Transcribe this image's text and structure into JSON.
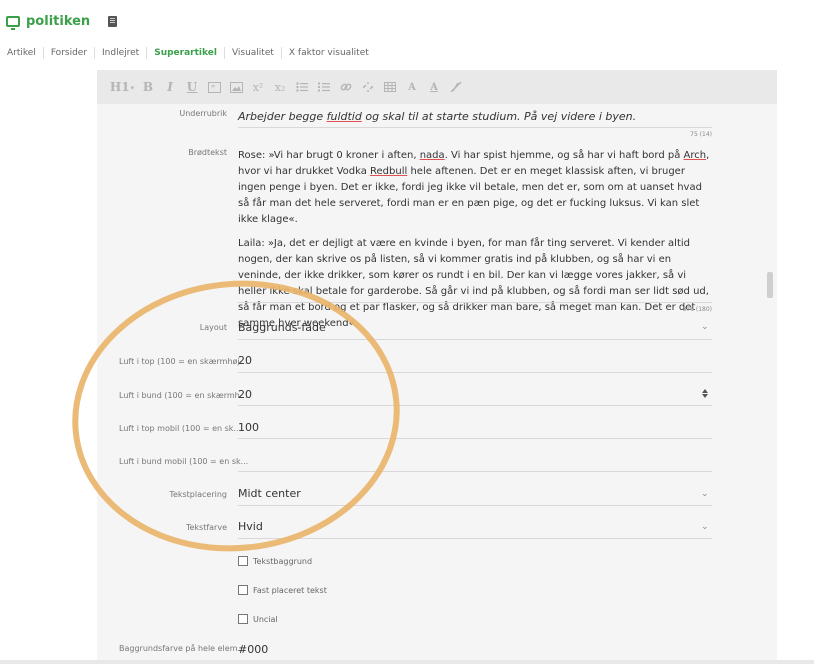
{
  "header": {
    "brand": "politiken"
  },
  "tabs": [
    {
      "label": "Artikel"
    },
    {
      "label": "Forsider"
    },
    {
      "label": "Indlejret"
    },
    {
      "label": "Superartikel",
      "active": true
    },
    {
      "label": "Visualitet"
    },
    {
      "label": "X faktor visualitet"
    }
  ],
  "toolbar": {
    "items": [
      "H1",
      "B",
      "I",
      "U",
      "quote",
      "image",
      "x²",
      "x₂",
      "list",
      "ordered-list",
      "link",
      "unlink",
      "table",
      "A",
      "A",
      "clear"
    ],
    "heading": "H1",
    "bold": "B",
    "italic": "I",
    "underline": "U",
    "superscript": "x²",
    "subscript": "x₂",
    "font_color": "A",
    "bg_color": "A"
  },
  "fields": {
    "underrubrik": {
      "label": "Underrubrik",
      "value_pre": "Arbejder begge ",
      "value_err": "fuldtid",
      "value_post": " og skal til at starte studium. På vej videre i byen.",
      "count": "75 (14)"
    },
    "brodtekst": {
      "label": "Brødtekst",
      "p1_a": "Rose: »Vi har brugt 0 kroner i aften, ",
      "p1_err1": "nada",
      "p1_b": ". Vi har spist hjemme, og så har vi haft bord på ",
      "p1_err2": "Arch",
      "p1_c": ", hvor vi har drukket Vodka ",
      "p1_err3": "Redbull",
      "p1_d": " hele aftenen. Det er en meget klassisk aften, vi bruger ingen penge i byen. Det er ikke, fordi jeg ikke vil betale, men det er, som om at uanset hvad så får man det hele serveret, fordi man er en pæn pige, og det er fucking luksus. Vi kan slet ikke klage«.",
      "p2": "Laila: »Ja, det er dejligt at være en kvinde i byen, for man får ting serveret. Vi kender altid nogen, der kan skrive os på listen, så vi kommer gratis ind på klubben, og så har vi en veninde, der ikke drikker, som kører os rundt i en bil. Der kan vi lægge vores jakker, så vi heller ikke skal betale for garderobe. Så går vi ind på klubben, og så fordi man ser lidt sød ud, så får man et bord og et par flasker, og så drikker man bare, så meget man kan. Det er det samme hver weekend«.",
      "count": "876 (180)"
    },
    "layout": {
      "label": "Layout",
      "value": "Baggrunds-fade"
    },
    "luft_top": {
      "label": "Luft i top (100 = en skærmhøj...",
      "value": "20"
    },
    "luft_bund": {
      "label": "Luft i bund (100 = en skærmh...",
      "value": "20"
    },
    "luft_top_mobil": {
      "label": "Luft i top mobil (100 = en sk...",
      "value": "100"
    },
    "luft_bund_mobil": {
      "label": "Luft i bund mobil (100 = en sk...",
      "value": ""
    },
    "tekstplacering": {
      "label": "Tekstplacering",
      "value": "Midt center"
    },
    "tekstfarve": {
      "label": "Tekstfarve",
      "value": "Hvid"
    },
    "checkboxes": [
      {
        "label": "Tekstbaggrund",
        "checked": false
      },
      {
        "label": "Fast placeret tekst",
        "checked": false
      },
      {
        "label": "Uncial",
        "checked": false
      }
    ],
    "baggrundsfarve": {
      "label": "Baggrundsfarve på hele elem...",
      "value": "#000"
    }
  },
  "colors": {
    "accent": "#3aa04a",
    "annotation": "#e8b46a",
    "spellcheck": "#e05050"
  }
}
